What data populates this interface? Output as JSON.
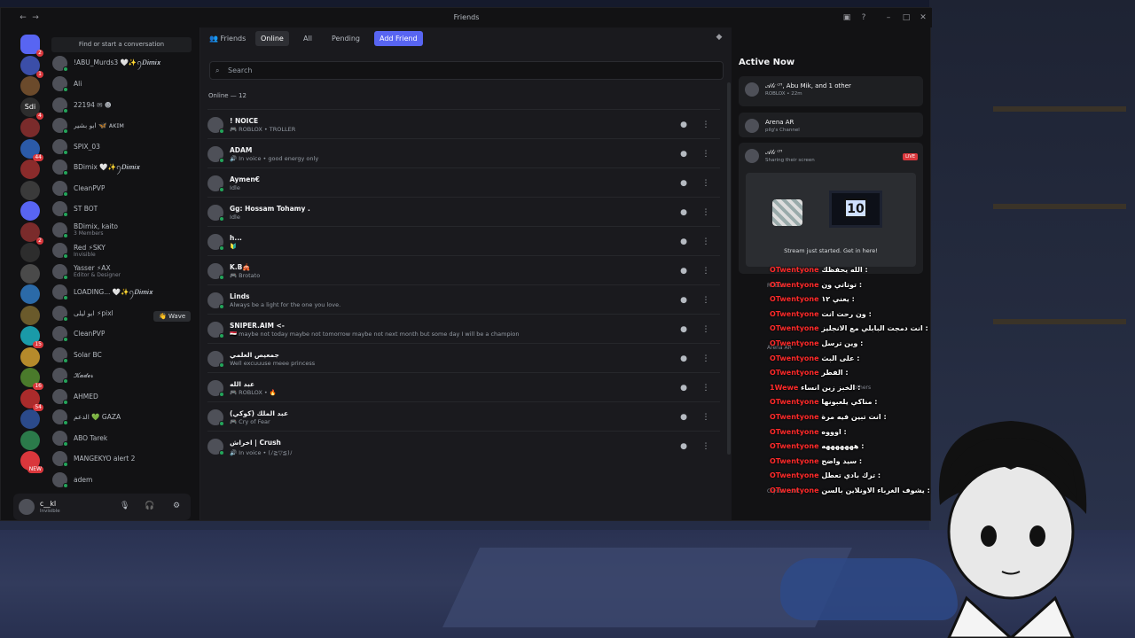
{
  "window": {
    "title": "Friends"
  },
  "sidebar": {
    "search_placeholder": "Find or start a conversation",
    "dms": [
      {
        "name": "!ABU_Murds3 🤍✨ꪆ𝑫𝒊𝒎𝒊𝒙 ",
        "sub": ""
      },
      {
        "name": "Ali",
        "sub": ""
      },
      {
        "name": "22194 ✉︎ ☻",
        "sub": ""
      },
      {
        "name": "ابو بشير 🦋 ᴀᴋɪᴍ",
        "sub": ""
      },
      {
        "name": "SPIX_03",
        "sub": ""
      },
      {
        "name": "BDimix 🤍✨ꪆ𝑫𝒊𝒎𝒊𝒙",
        "sub": ""
      },
      {
        "name": "CleanPVP",
        "sub": ""
      },
      {
        "name": "ST BOT",
        "sub": ""
      },
      {
        "name": "BDimix, kaito",
        "sub": "3 Members"
      },
      {
        "name": "Red ⚡SKY",
        "sub": "Invisible"
      },
      {
        "name": "Yasser ⚡AX",
        "sub": "Editor & Designer"
      },
      {
        "name": "LOADING... 🤍✨ꪆ𝑫𝒊𝒎𝒊𝒙",
        "sub": ""
      },
      {
        "name": "ابو ليلى ⚡pixl",
        "sub": ""
      },
      {
        "name": "CleanPVP",
        "sub": ""
      },
      {
        "name": "Solar BC",
        "sub": ""
      },
      {
        "name": "𝓚𝓪𝓭𝓮𝓻",
        "sub": ""
      },
      {
        "name": "AHMED",
        "sub": ""
      },
      {
        "name": "الدعم 💚 GAZA",
        "sub": ""
      },
      {
        "name": "ABO Tarek",
        "sub": ""
      },
      {
        "name": "MANGEKYO alert 2",
        "sub": ""
      },
      {
        "name": "adem",
        "sub": ""
      }
    ],
    "wave_label": "👋 Wave"
  },
  "guilds": {
    "badges": [
      "2",
      "1",
      "",
      "4",
      "",
      "44",
      "",
      "",
      "",
      "2",
      "",
      "",
      "",
      "",
      "15",
      "",
      "16",
      "54",
      "",
      "",
      "NEW"
    ],
    "labels": [
      "",
      "",
      "",
      "Sdi",
      "",
      "",
      "",
      "",
      "",
      "",
      "",
      "",
      "",
      "",
      "",
      "",
      "",
      "",
      "",
      "",
      ""
    ]
  },
  "userbar": {
    "name": "c__kl",
    "status": "Invisible"
  },
  "topbar": {
    "friends": "Friends",
    "online": "Online",
    "all": "All",
    "pending": "Pending",
    "add_friend": "Add Friend"
  },
  "main": {
    "search_placeholder": "Search",
    "online_count": "Online — 12",
    "friends": [
      {
        "name": "! NOICE",
        "status": "🎮 ROBLOX • TROLLER"
      },
      {
        "name": "ADAM",
        "status": "🔊 In voice • good energy only"
      },
      {
        "name": "Aymen€",
        "status": "Idle"
      },
      {
        "name": "Gg: Hossam Tohamy .",
        "status": "Idle"
      },
      {
        "name": "h...",
        "status": "🔰"
      },
      {
        "name": "K.B🎪",
        "status": "🎮 Brotato"
      },
      {
        "name": "Linds",
        "status": "Always be a light for the one you love."
      },
      {
        "name": "SNIPER.AIM <-",
        "status": "🇪🇬 maybe not today maybe not tomorrow maybe not next month but some day I will be a champion"
      },
      {
        "name": "جمعيص العلمي",
        "status": "Well excuuuse meee princess"
      },
      {
        "name": "عبد الله",
        "status": "🎮 ROBLOX • 🔥"
      },
      {
        "name": "عبد الملك (كوكي)",
        "status": "🎮 Cry of Fear"
      },
      {
        "name": "اخراش | Crush",
        "status": "🔊 In voice • (ﾉ≧▽≦)ﾉ"
      }
    ]
  },
  "active_now": {
    "title": "Active Now",
    "cards": [
      {
        "title": "𝒜𝓁𝒾 ᶜᴴ, Abu Mik, and 1 other",
        "sub": "ROBLOX • 22m"
      },
      {
        "title": "Arena AR",
        "sub": "pilg's Channel"
      },
      {
        "title": "𝒜𝓁𝒾 ᶜᴴ",
        "sub": "Sharing their screen"
      }
    ],
    "live_label": "LIVE",
    "stream_caption": "Stream just started. Get in here!",
    "tv_number": "10",
    "faded": [
      "ROBLOX",
      "Arena AR",
      "others",
      "Crystal Lord"
    ]
  },
  "chat_overlay": {
    "messages": [
      {
        "user": "OTwentyone",
        "text": "الله يحفظك :"
      },
      {
        "user": "OTwentyone",
        "text": "توتاتي ون :"
      },
      {
        "user": "OTwentyone",
        "text": "يعني ١٢ :"
      },
      {
        "user": "OTwentyone",
        "text": "ون رحت انت :"
      },
      {
        "user": "OTwentyone",
        "text": "انت دمجت البابلي مع الانجليز :"
      },
      {
        "user": "OTwentyone",
        "text": "وين ترسل :"
      },
      {
        "user": "OTwentyone",
        "text": "على البث :"
      },
      {
        "user": "OTwentyone",
        "text": "الفطر :"
      },
      {
        "user": "1Wewe",
        "text": "الخبز زين انساء :"
      },
      {
        "user": "OTwentyone",
        "text": "مناكي يلعبونها :"
      },
      {
        "user": "OTwentyone",
        "text": "انت تبين فيه مرة :"
      },
      {
        "user": "OTwentyone",
        "text": "اوووه :"
      },
      {
        "user": "OTwentyone",
        "text": "هههههههه :"
      },
      {
        "user": "OTwentyone",
        "text": "سيد واضح :"
      },
      {
        "user": "OTwentyone",
        "text": "ترك بادي تعطل :"
      },
      {
        "user": "OTwentyone",
        "text": "يشوف الغرباء الاونلاين بالسن :"
      }
    ]
  },
  "colors": {
    "accent": "#5865f2",
    "online": "#23a55a",
    "live": "#da373c",
    "chat_user": "#ff2a2a"
  }
}
